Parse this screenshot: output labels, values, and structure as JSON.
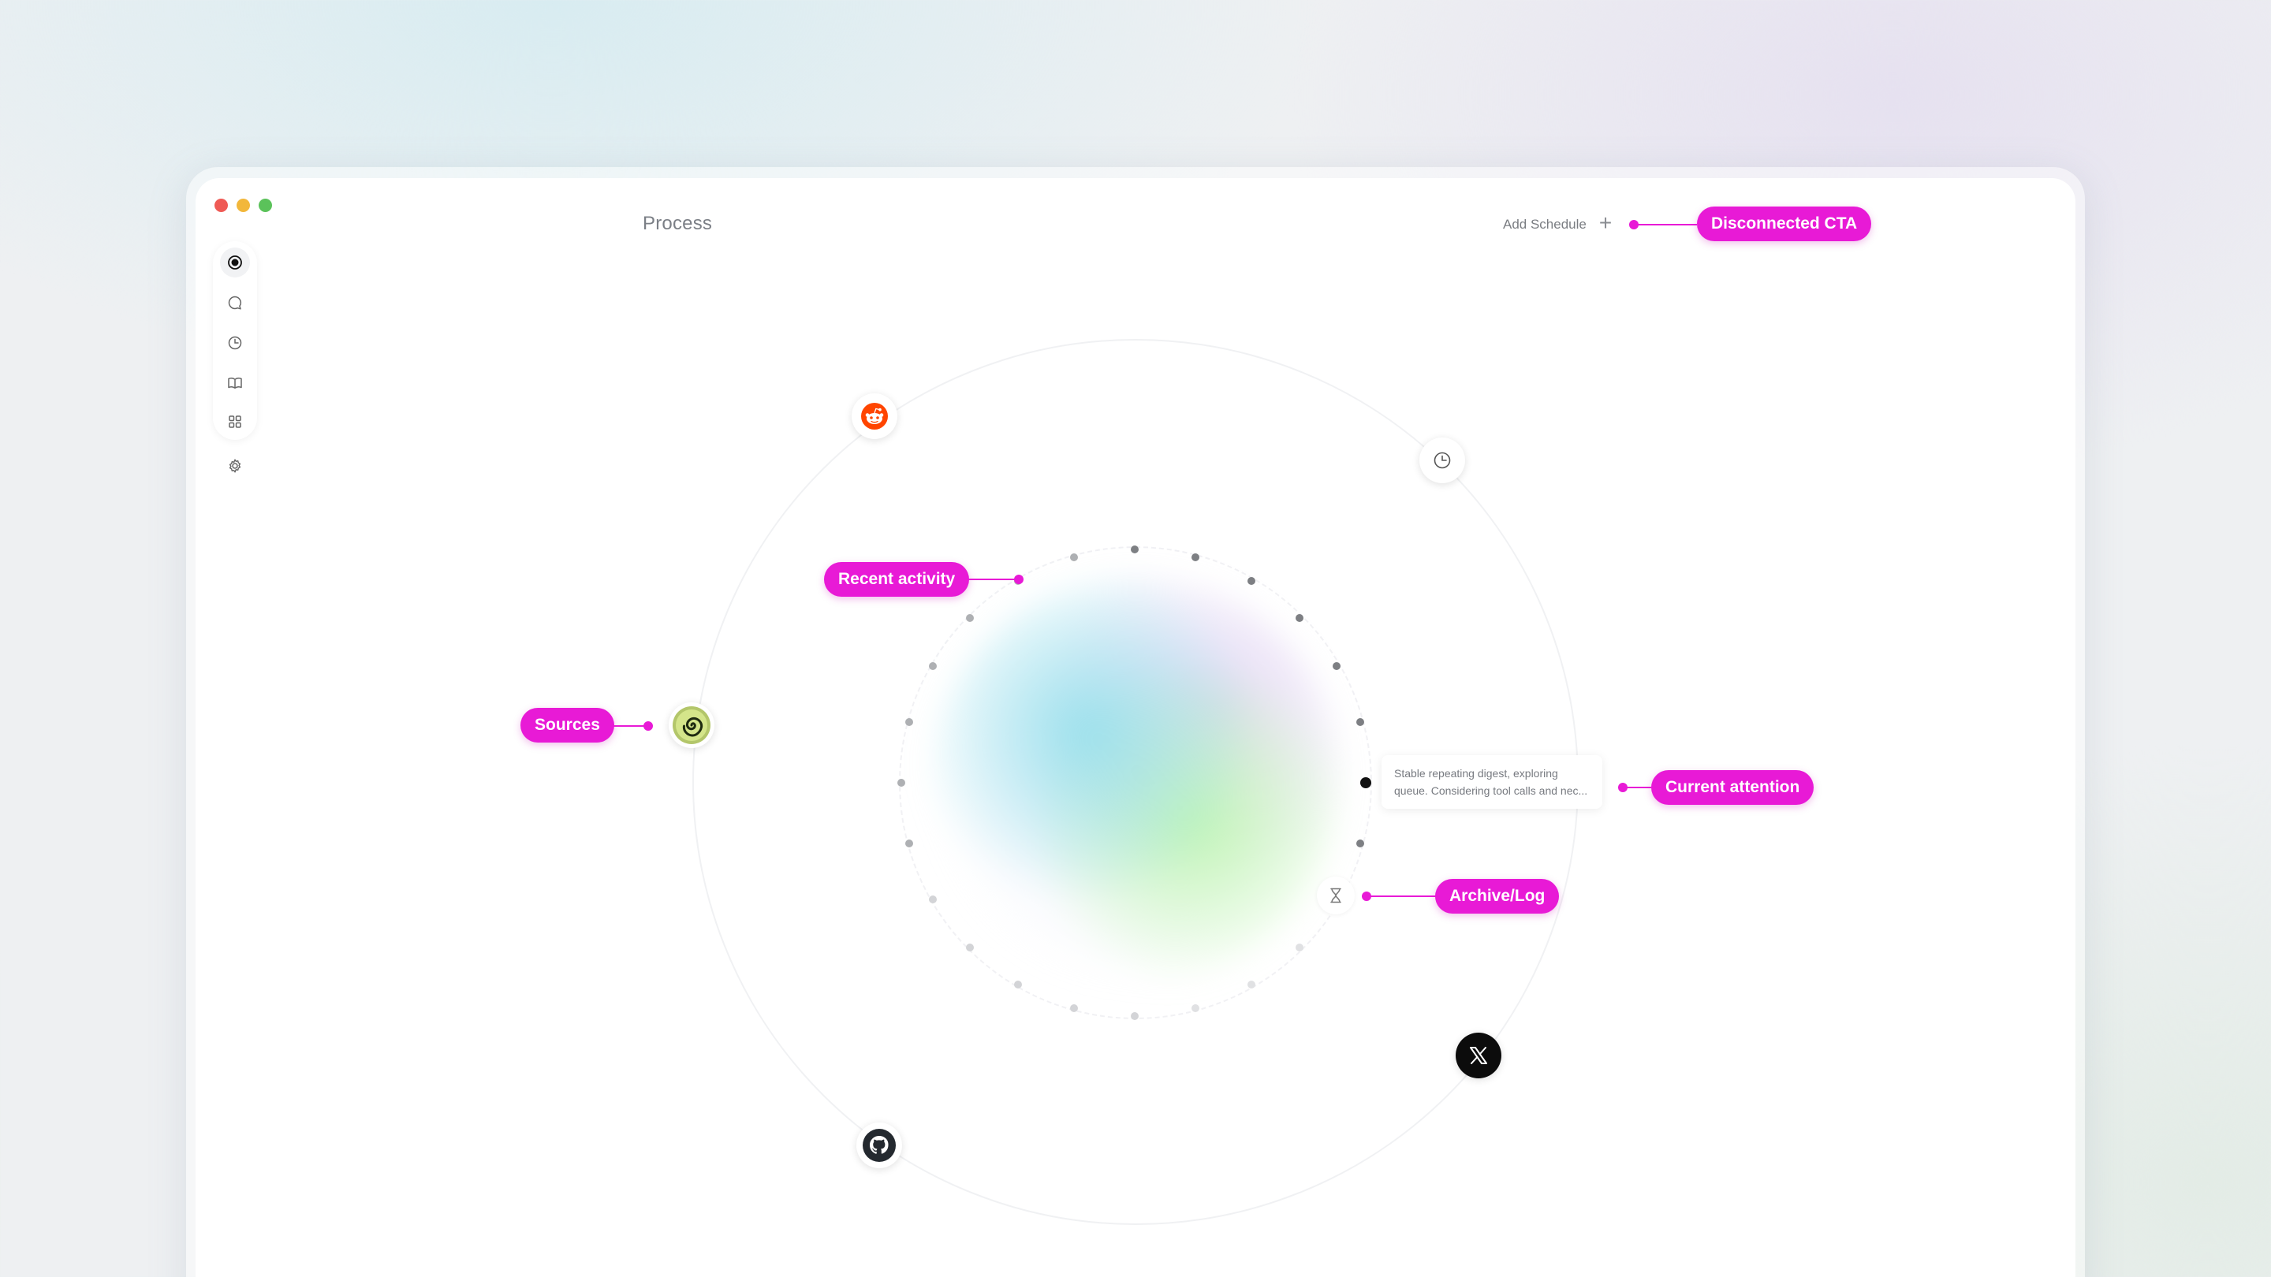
{
  "window": {
    "title": "Process"
  },
  "header": {
    "add_schedule_label": "Add Schedule",
    "add_icon": "plus-icon"
  },
  "sidebar": {
    "items": [
      {
        "name": "process",
        "icon": "radio-dot-icon",
        "active": true
      },
      {
        "name": "chat",
        "icon": "chat-bubble-icon"
      },
      {
        "name": "history",
        "icon": "clock-icon"
      },
      {
        "name": "library",
        "icon": "book-icon"
      },
      {
        "name": "apps",
        "icon": "grid-icon"
      },
      {
        "name": "settings",
        "icon": "gear-icon"
      }
    ]
  },
  "orbit": {
    "sources": [
      {
        "name": "reddit",
        "icon": "reddit-icon"
      },
      {
        "name": "schedule",
        "icon": "clock-icon"
      },
      {
        "name": "spiral",
        "icon": "spiral-icon"
      },
      {
        "name": "x",
        "icon": "x-logo-icon"
      },
      {
        "name": "github",
        "icon": "github-icon"
      }
    ]
  },
  "attention": {
    "line1": "Stable repeating digest, exploring",
    "line2": "queue. Considering tool calls and nec..."
  },
  "archive": {
    "icon": "hourglass-icon"
  },
  "callouts": {
    "disconnected_cta": "Disconnected CTA",
    "recent_activity": "Recent activity",
    "sources": "Sources",
    "current_attention": "Current attention",
    "archive_log": "Archive/Log"
  },
  "colors": {
    "callout": "#e81ad6",
    "reddit": "#ff4500",
    "traffic_red": "#ef5a55",
    "traffic_yellow": "#f2b73b",
    "traffic_green": "#5bc25a"
  }
}
